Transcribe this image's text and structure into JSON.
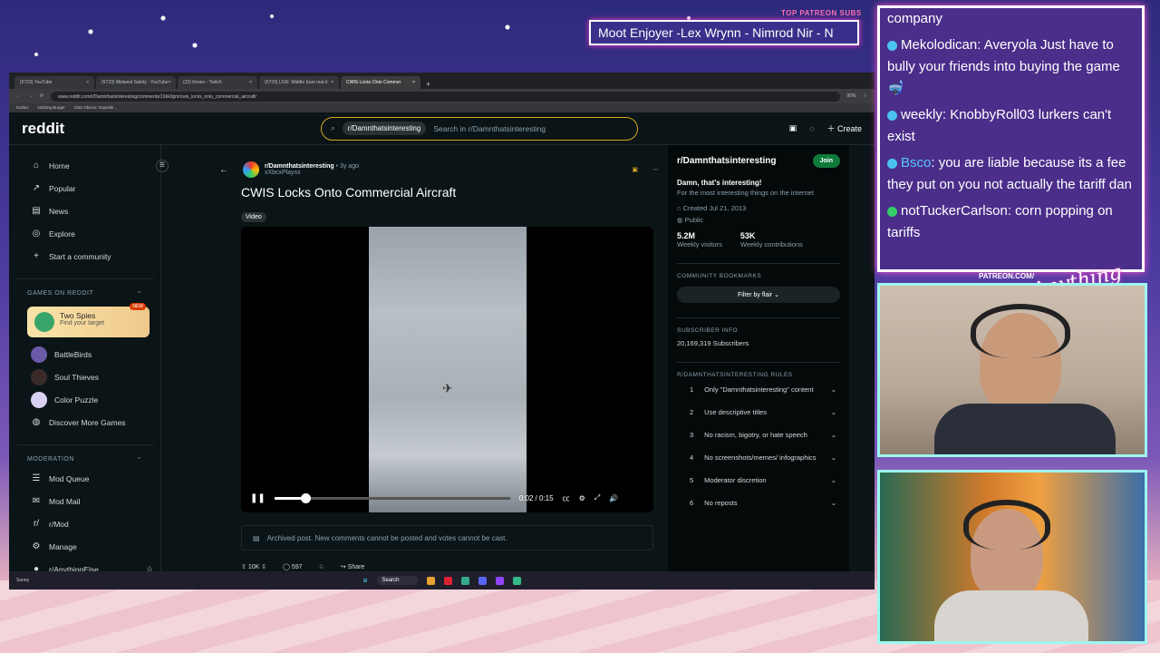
{
  "overlay": {
    "patreon_label": "TOP PATREON SUBS",
    "ticker_text": "Moot Enjoyer -Lex Wrynn - Nimrod Nir - N",
    "patreon_url": "PATREON.COM/",
    "brand": "Anything Else",
    "chat": [
      {
        "user": "",
        "text": "company"
      },
      {
        "user": "Mekolodican:",
        "text": " Averyola Just have to bully your friends into buying the game 🤿"
      },
      {
        "user": "weekly:",
        "text": " KnobbyRoll03 lurkers can't exist"
      },
      {
        "user": "Bsco",
        "text": ": you are liable because its a fee they put on you not actually the tariff dan"
      },
      {
        "user": "notTuckerCarlson:",
        "text": " corn popping on tariffs"
      }
    ]
  },
  "browser": {
    "tabs": [
      "(5723) YouTube",
      "(5723) Midwest Safety - YouTube",
      "(33) forsen - Twitch",
      "(5723) LIVE: Middle East real-ti",
      "CWIS Locks Onto Commer"
    ],
    "url": "www.reddit.com/r/Damnthatsinteresting/comments/13kk0gm/cwis_locks_onto_commercial_aircraft/",
    "zoom": "90%",
    "bookmarks": [
      "Dailies",
      "Nothing Burger",
      "Clair Obscur: Expediti..."
    ]
  },
  "header": {
    "logo": "reddit",
    "search_chip": "r/Damnthatsinteresting",
    "search_placeholder": "Search in r/Damnthatsinteresting",
    "create_label": "Create"
  },
  "sidebar": {
    "nav": [
      {
        "icon": "⌂",
        "label": "Home"
      },
      {
        "icon": "↗",
        "label": "Popular"
      },
      {
        "icon": "▤",
        "label": "News"
      },
      {
        "icon": "◎",
        "label": "Explore"
      },
      {
        "icon": "+",
        "label": "Start a community"
      }
    ],
    "games_header": "GAMES ON REDDIT",
    "promo": {
      "title": "Two Spies",
      "subtitle": "Find your target",
      "badge": "NEW"
    },
    "games": [
      "BattleBirds",
      "Soul Thieves",
      "Color Puzzle"
    ],
    "discover": "Discover More Games",
    "moderation_header": "MODERATION",
    "mod_items": [
      "Mod Queue",
      "Mod Mail",
      "r/Mod",
      "Manage",
      "r/AnythingElse"
    ]
  },
  "post": {
    "subreddit": "r/Damnthatsinteresting",
    "age": "• 3y ago",
    "author": "xXbcxPlaysx",
    "title": "CWIS Locks Onto Commercial Aircraft",
    "flair": "Video",
    "time": "0:02 / 0:15",
    "progress": 0.13,
    "archived": "Archived post. New comments cannot be posted and votes cannot be cast.",
    "votes": "10K",
    "comments": "597",
    "share": "Share"
  },
  "community": {
    "name": "r/Damnthatsinteresting",
    "join": "Join",
    "tagline": "Damn, that's interesting!",
    "description": "For the most interesting things on the internet",
    "created": "Created Jul 21, 2013",
    "visibility": "Public",
    "visitors": "5.2M",
    "visitors_label": "Weekly visitors",
    "contributions": "53K",
    "contributions_label": "Weekly contributions",
    "bookmarks_header": "COMMUNITY BOOKMARKS",
    "filter": "Filter by flair",
    "subscriber_header": "SUBSCRIBER INFO",
    "subscribers": "20,169,319 Subscribers",
    "rules_header": "R/DAMNTHATSINTERESTING RULES",
    "rules": [
      "Only \"Damnthatsinteresting\" content",
      "Use descriptive titles",
      "No racism, bigotry, or hate speech",
      "No screenshots/memes/ infographics",
      "Moderator discretion",
      "No reposts"
    ]
  },
  "taskbar": {
    "weather": "Sunny",
    "search": "Search"
  }
}
